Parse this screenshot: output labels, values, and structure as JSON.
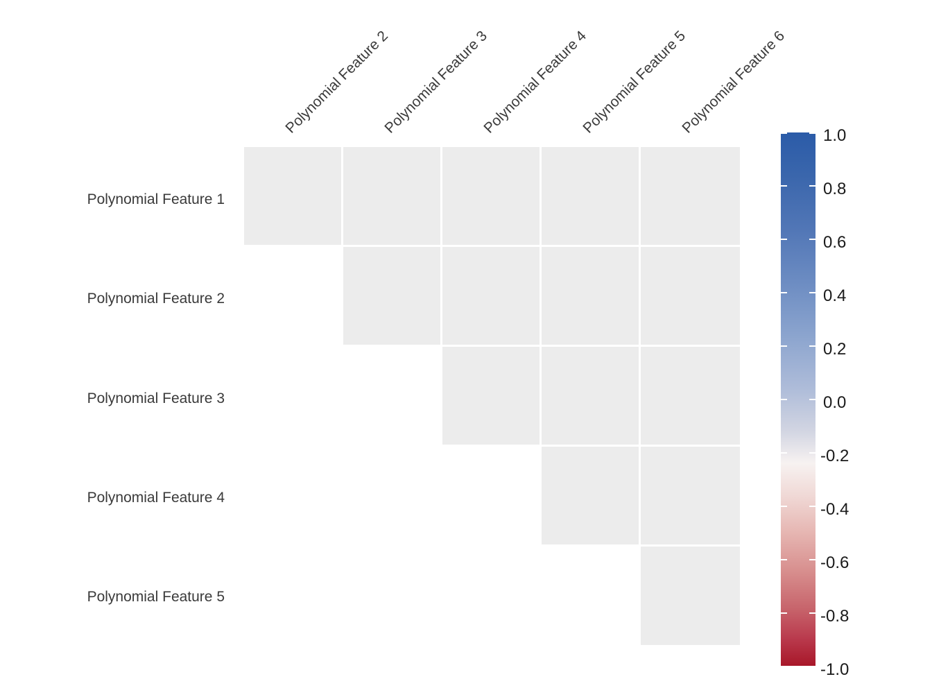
{
  "chart_data": {
    "type": "heatmap",
    "title": "",
    "xlabel": "",
    "ylabel": "",
    "grid": false,
    "mask": "upper-triangle-hidden (lower/staircase cells shown, all values empty)",
    "row_labels": [
      "Polynomial Feature 1",
      "Polynomial Feature 2",
      "Polynomial Feature 3",
      "Polynomial Feature 4",
      "Polynomial Feature 5"
    ],
    "column_labels": [
      "Polynomial Feature 2",
      "Polynomial Feature 3",
      "Polynomial Feature 4",
      "Polynomial Feature 5",
      "Polynomial Feature 6"
    ],
    "cell_fill_color": "#ececec",
    "values": [
      [
        null,
        null,
        null,
        null,
        null
      ],
      [
        null,
        null,
        null,
        null,
        null
      ],
      [
        null,
        null,
        null,
        null,
        null
      ],
      [
        null,
        null,
        null,
        null,
        null
      ],
      [
        null,
        null,
        null,
        null,
        null
      ]
    ],
    "cell_visible": [
      [
        true,
        true,
        true,
        true,
        true
      ],
      [
        false,
        true,
        true,
        true,
        true
      ],
      [
        false,
        false,
        true,
        true,
        true
      ],
      [
        false,
        false,
        false,
        true,
        true
      ],
      [
        false,
        false,
        false,
        false,
        true
      ]
    ],
    "colorbar": {
      "orientation": "vertical",
      "position": "right",
      "vmin": -1.0,
      "vmax": 1.0,
      "tick_labels": [
        "1.0",
        "0.8",
        "0.6",
        "0.4",
        "0.2",
        "0.0",
        "-0.2",
        "-0.4",
        "-0.6",
        "-0.8",
        "-1.0"
      ],
      "tick_values": [
        1.0,
        0.8,
        0.6,
        0.4,
        0.2,
        0.0,
        -0.2,
        -0.4,
        -0.6,
        -0.8,
        -1.0
      ],
      "colormap": "coolwarm / RdBu diverging",
      "color_high": "#2b5ba8",
      "color_mid": "#f7f2f1",
      "color_low": "#a81729"
    }
  },
  "plot": {
    "background_color": "#ffffff",
    "tick_label_color": "#3a3a3a",
    "colorbar_label_color": "#1a1a1a"
  }
}
